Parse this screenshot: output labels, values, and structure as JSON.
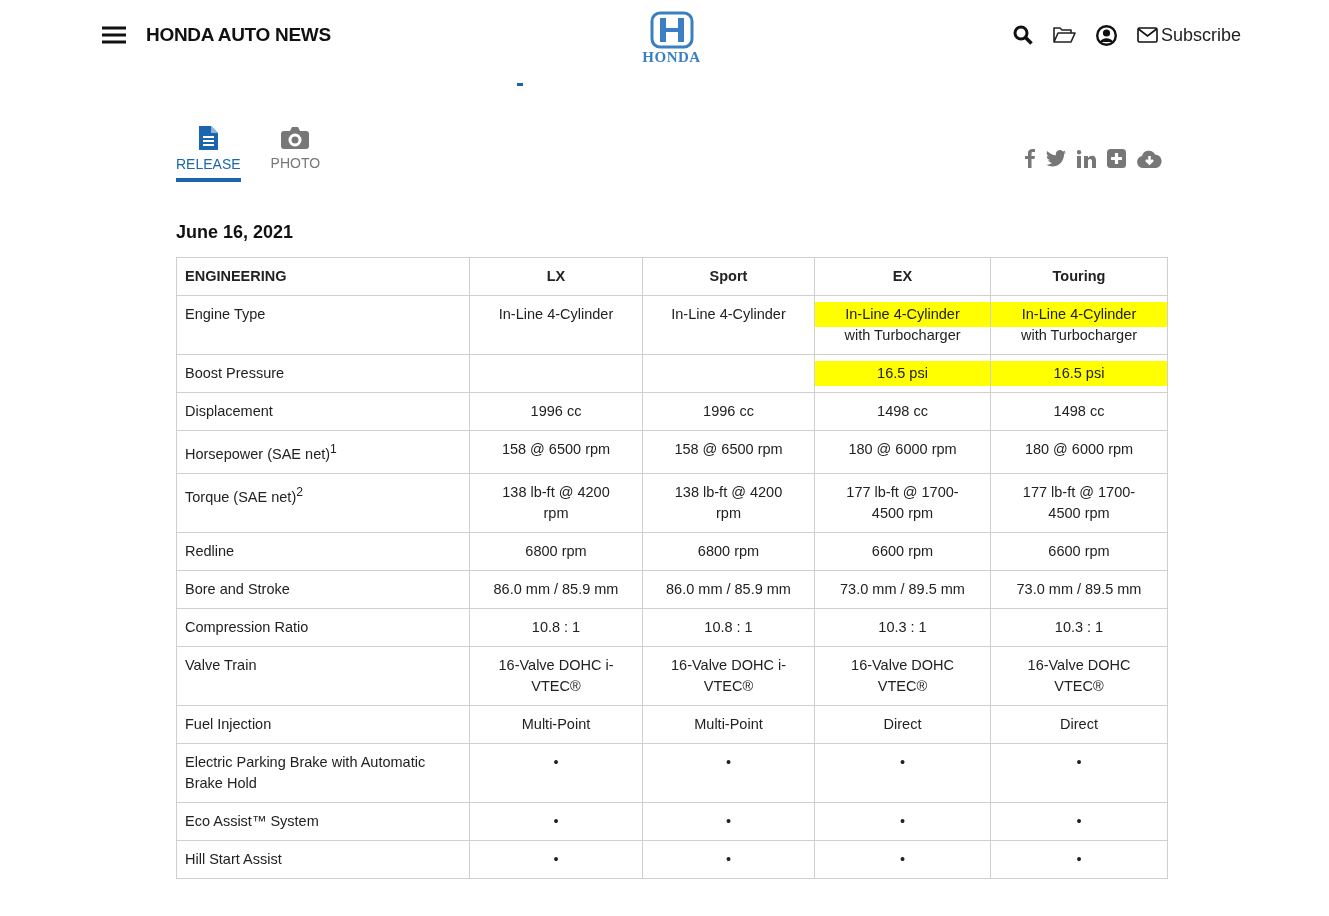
{
  "header": {
    "site_title": "HONDA AUTO NEWS",
    "logo_text": "HONDA",
    "subscribe": "Subscribe"
  },
  "tabs": [
    {
      "label": "RELEASE",
      "selected": true
    },
    {
      "label": "PHOTO",
      "selected": false
    }
  ],
  "date": "June 16, 2021",
  "table": {
    "columns": [
      "ENGINEERING",
      "LX",
      "Sport",
      "EX",
      "Touring"
    ],
    "rows": [
      {
        "cells": [
          {
            "text": "Engine Type",
            "highlighted": false
          },
          {
            "text": "In-Line 4-Cylinder",
            "highlighted": false
          },
          {
            "text": "In-Line 4-Cylinder",
            "highlighted": false
          },
          {
            "text": "In-Line 4-Cylinder with Turbocharger",
            "highlighted": true
          },
          {
            "text": "In-Line 4-Cylinder with Turbocharger",
            "highlighted": true
          }
        ]
      },
      {
        "cells": [
          {
            "text": "Boost Pressure",
            "highlighted": false
          },
          {
            "text": "",
            "highlighted": false
          },
          {
            "text": "",
            "highlighted": false
          },
          {
            "text": "16.5 psi",
            "highlighted": true
          },
          {
            "text": "16.5 psi",
            "highlighted": true
          }
        ]
      },
      {
        "cells": [
          {
            "text": "Displacement",
            "highlighted": false
          },
          {
            "text": "1996 cc",
            "highlighted": false
          },
          {
            "text": "1996 cc",
            "highlighted": false
          },
          {
            "text": "1498 cc",
            "highlighted": false
          },
          {
            "text": "1498 cc",
            "highlighted": false
          }
        ]
      },
      {
        "cells": [
          {
            "text": "Horsepower (SAE net)$^{1}$",
            "highlighted": false
          },
          {
            "text": "158 @ 6500 rpm",
            "highlighted": false
          },
          {
            "text": "158 @ 6500 rpm",
            "highlighted": false
          },
          {
            "text": "180 @ 6000 rpm",
            "highlighted": false
          },
          {
            "text": "180 @ 6000 rpm",
            "highlighted": false
          }
        ]
      },
      {
        "cells": [
          {
            "text": "Torque (SAE net)$^{2}$",
            "highlighted": false
          },
          {
            "text": "138 lb-ft @ 4200 rpm",
            "highlighted": false
          },
          {
            "text": "138 lb-ft @ 4200 rpm",
            "highlighted": false
          },
          {
            "text": "177 lb-ft @ 1700-4500 rpm",
            "highlighted": false
          },
          {
            "text": "177 lb-ft @ 1700-4500 rpm",
            "highlighted": false
          }
        ]
      },
      {
        "cells": [
          {
            "text": "Redline",
            "highlighted": false
          },
          {
            "text": "6800 rpm",
            "highlighted": false
          },
          {
            "text": "6800 rpm",
            "highlighted": false
          },
          {
            "text": "6600 rpm",
            "highlighted": false
          },
          {
            "text": "6600 rpm",
            "highlighted": false
          }
        ]
      },
      {
        "cells": [
          {
            "text": "Bore and Stroke",
            "highlighted": false
          },
          {
            "text": "86.0 mm / 85.9 mm",
            "highlighted": false
          },
          {
            "text": "86.0 mm / 85.9 mm",
            "highlighted": false
          },
          {
            "text": "73.0 mm / 89.5 mm",
            "highlighted": false
          },
          {
            "text": "73.0 mm / 89.5 mm",
            "highlighted": false
          }
        ]
      },
      {
        "cells": [
          {
            "text": "Compression Ratio",
            "highlighted": false
          },
          {
            "text": "10.8 : 1",
            "highlighted": false
          },
          {
            "text": "10.8 : 1",
            "highlighted": false
          },
          {
            "text": "10.3 : 1",
            "highlighted": false
          },
          {
            "text": "10.3 : 1",
            "highlighted": false
          }
        ]
      },
      {
        "cells": [
          {
            "text": "Valve Train",
            "highlighted": false
          },
          {
            "text": "16-Valve DOHC i-VTEC®",
            "highlighted": false
          },
          {
            "text": "16-Valve DOHC i-VTEC®",
            "highlighted": false
          },
          {
            "text": "16-Valve DOHC VTEC®",
            "highlighted": false
          },
          {
            "text": "16-Valve DOHC VTEC®",
            "highlighted": false
          }
        ]
      },
      {
        "cells": [
          {
            "text": "Fuel Injection",
            "highlighted": false
          },
          {
            "text": "Multi-Point",
            "highlighted": false
          },
          {
            "text": "Multi-Point",
            "highlighted": false
          },
          {
            "text": "Direct",
            "highlighted": false
          },
          {
            "text": "Direct",
            "highlighted": false
          }
        ]
      },
      {
        "cells": [
          {
            "text": "Electric Parking Brake with Automatic Brake Hold",
            "highlighted": false
          },
          {
            "text": "•",
            "highlighted": false
          },
          {
            "text": "•",
            "highlighted": false
          },
          {
            "text": "•",
            "highlighted": false
          },
          {
            "text": "•",
            "highlighted": false
          }
        ]
      },
      {
        "cells": [
          {
            "text": "Eco Assist™ System",
            "highlighted": false
          },
          {
            "text": "•",
            "highlighted": false
          },
          {
            "text": "•",
            "highlighted": false
          },
          {
            "text": "•",
            "highlighted": false
          },
          {
            "text": "•",
            "highlighted": false
          }
        ]
      },
      {
        "cells": [
          {
            "text": "Hill Start Assist",
            "highlighted": false
          },
          {
            "text": "•",
            "highlighted": false
          },
          {
            "text": "•",
            "highlighted": false
          },
          {
            "text": "•",
            "highlighted": false
          },
          {
            "text": "•",
            "highlighted": false
          }
        ]
      }
    ]
  }
}
